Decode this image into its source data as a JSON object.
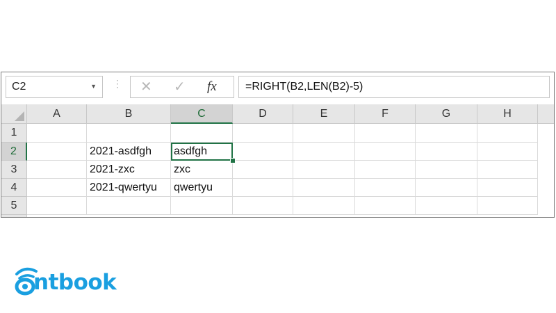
{
  "formula_bar": {
    "name_box": "C2",
    "formula": "=RIGHT(B2,LEN(B2)-5)",
    "cancel_icon": "close-icon",
    "enter_icon": "checkmark-icon",
    "function_icon": "fx-icon"
  },
  "columns": [
    "A",
    "B",
    "C",
    "D",
    "E",
    "F",
    "G",
    "H"
  ],
  "rows": [
    "1",
    "2",
    "3",
    "4",
    "5"
  ],
  "cells": {
    "B2": "2021-asdfgh",
    "C2": "asdfgh",
    "B3": "2021-zxc",
    "C3": "zxc",
    "B4": "2021-qwertyu",
    "C4": "qwertyu"
  },
  "selection": {
    "active_cell": "C2",
    "accent_color": "#217346"
  },
  "logo": {
    "text": "ntbook",
    "brand_color": "#1a9fe0"
  }
}
